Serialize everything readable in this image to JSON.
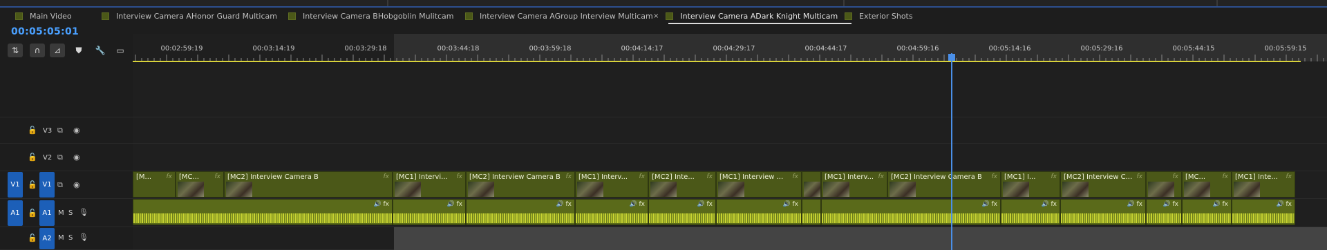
{
  "tabs": [
    {
      "label": "Main Video"
    },
    {
      "label": "Interview Camera AHonor Guard Multicam"
    },
    {
      "label": "Interview Camera BHobgoblin Mulitcam"
    },
    {
      "label": "Interview Camera AGroup Interview Multicam"
    },
    {
      "label": "Interview Camera ADark Knight Multicam",
      "active": true,
      "close_icon": "close-icon",
      "menu_icon": "menu-icon"
    },
    {
      "label": "Exterior Shots"
    }
  ],
  "timecode": "00:05:05:01",
  "toolbar": {
    "tools": [
      "insert-overwrite-icon",
      "snap-magnet-icon",
      "linked-selection-icon",
      "marker-icon",
      "wrench-icon",
      "captions-icon"
    ]
  },
  "ruler": {
    "ticks": [
      "00:02:59:19",
      "00:03:14:19",
      "00:03:29:18",
      "00:03:44:18",
      "00:03:59:18",
      "00:04:14:17",
      "00:04:29:17",
      "00:04:44:17",
      "00:04:59:16",
      "00:05:14:16",
      "00:05:29:16",
      "00:05:44:15",
      "00:05:59:15"
    ]
  },
  "tracks": {
    "v3": {
      "label": "V3"
    },
    "v2": {
      "label": "V2"
    },
    "v1": {
      "label": "V1",
      "source": "V1"
    },
    "a1": {
      "label": "A1",
      "source": "A1",
      "m": "M",
      "s": "S"
    },
    "a2": {
      "label": "A2",
      "m": "M",
      "s": "S"
    }
  },
  "video_clips": [
    {
      "label": "[M...",
      "fx": "fx"
    },
    {
      "label": "[MC...",
      "fx": "fx"
    },
    {
      "label": "[MC2] Interview Camera B",
      "fx": "fx"
    },
    {
      "label": "[MC1] Intervi...",
      "fx": "fx"
    },
    {
      "label": "[MC2] Interview Camera B",
      "fx": "fx"
    },
    {
      "label": "[MC1] Interv...",
      "fx": "fx"
    },
    {
      "label": "[MC2] Inte...",
      "fx": "fx"
    },
    {
      "label": "[MC1] Interview ...",
      "fx": "fx"
    },
    {
      "label": "",
      "fx": ""
    },
    {
      "label": "[MC1] Interv...",
      "fx": "fx"
    },
    {
      "label": "[MC2] Interview Camera B",
      "fx": "fx"
    },
    {
      "label": "[MC1] I...",
      "fx": "fx"
    },
    {
      "label": "[MC2] Interview C...",
      "fx": "fx"
    },
    {
      "label": "",
      "fx": "fx"
    },
    {
      "label": "[MC...",
      "fx": "fx"
    },
    {
      "label": "[MC1] Inte...",
      "fx": "fx"
    }
  ],
  "audio_clip_icons": "🔊 fx",
  "colors": {
    "accent": "#4aa0ff",
    "clip": "#4b5818",
    "track_target": "#1c5fb8",
    "playhead": "#4a8fe8",
    "work_area": "#d8d23a"
  }
}
